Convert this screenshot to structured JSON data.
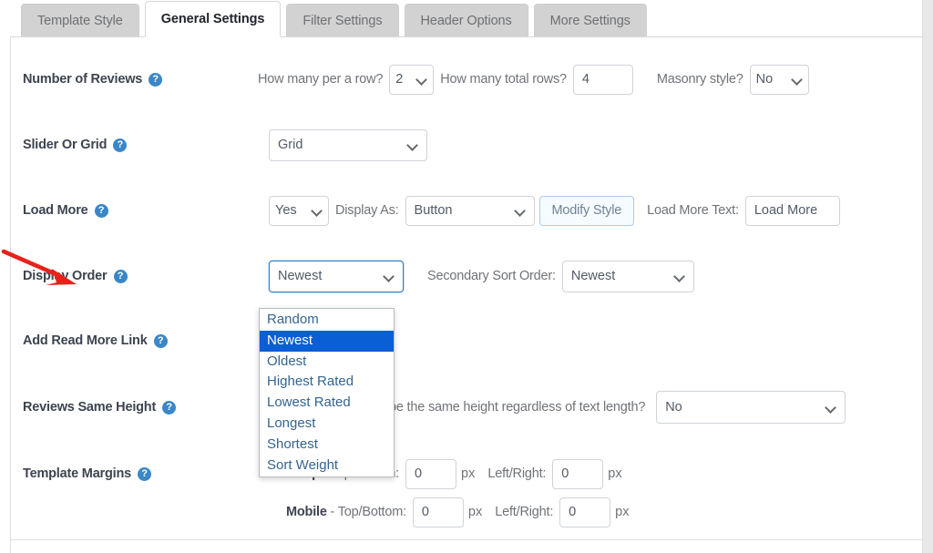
{
  "tabs": [
    {
      "label": "Template Style",
      "active": false
    },
    {
      "label": "General Settings",
      "active": true
    },
    {
      "label": "Filter Settings",
      "active": false
    },
    {
      "label": "Header Options",
      "active": false
    },
    {
      "label": "More Settings",
      "active": false
    }
  ],
  "help_glyph": "?",
  "rows": {
    "number_of_reviews": {
      "label": "Number of Reviews",
      "per_row_label": "How many per a row?",
      "per_row_value": "2",
      "total_rows_label": "How many total rows?",
      "total_rows_value": "4",
      "masonry_label": "Masonry style?",
      "masonry_value": "No"
    },
    "slider_or_grid": {
      "label": "Slider Or Grid",
      "value": "Grid"
    },
    "load_more": {
      "label": "Load More",
      "enabled_value": "Yes",
      "display_as_label": "Display As:",
      "display_as_value": "Button",
      "modify_style_label": "Modify Style",
      "text_label": "Load More Text:",
      "text_value": "Load More"
    },
    "display_order": {
      "label": "Display Order",
      "value": "Newest",
      "secondary_label": "Secondary Sort Order:",
      "secondary_value": "Newest",
      "options": [
        "Random",
        "Newest",
        "Oldest",
        "Highest Rated",
        "Lowest Rated",
        "Longest",
        "Shortest",
        "Sort Weight"
      ],
      "selected_option": "Newest"
    },
    "add_read_more_link": {
      "label": "Add Read More Link"
    },
    "reviews_same_height": {
      "label": "Reviews Same Height",
      "question": "be the same height regardless of text length?",
      "value": "No"
    },
    "template_margins": {
      "label": "Template Margins",
      "desktop_prefix": "Desktop",
      "mobile_prefix": "Mobile",
      "dash": " - ",
      "top_bottom_label": "Top/Bottom:",
      "left_right_label": "Left/Right:",
      "unit": "px",
      "desktop_top_bottom": "0",
      "desktop_left_right": "0",
      "mobile_top_bottom": "0",
      "mobile_left_right": "0"
    }
  },
  "annotation": {
    "arrow_color": "#e8221a"
  }
}
